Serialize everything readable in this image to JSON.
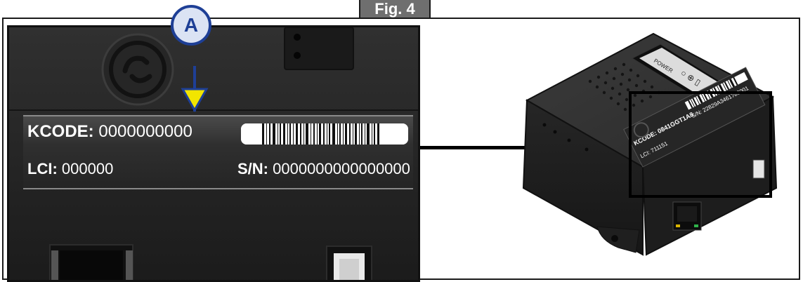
{
  "figure": {
    "label": "Fig. 4"
  },
  "callout": {
    "letter": "A",
    "color": "#1e3f96",
    "arrow_color": "#f2e500"
  },
  "zoom_label": {
    "kcode_label": "KCODE:",
    "kcode_value": "0000000000",
    "lci_label": "LCI:",
    "lci_value": "000000",
    "sn_label": "S/N:",
    "sn_value": "0000000000000000"
  },
  "device_label": {
    "kcode_label": "KCODE:",
    "kcode_value": "0841GGT1A8",
    "lci_label": "LCI:",
    "lci_value": "711151",
    "sn_label": "S/N:",
    "sn_value": "22829A3461780001",
    "power_text": "POWER"
  }
}
